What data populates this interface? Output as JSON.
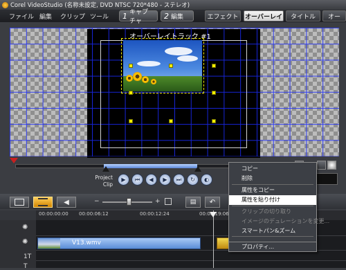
{
  "window": {
    "title": "Corel VideoStudio (名称未設定, DVD NTSC 720*480 - ステレオ)"
  },
  "menu": [
    "ファイル",
    "編集",
    "クリップ",
    "ツール"
  ],
  "steps": [
    {
      "num": "1",
      "label": "キャプチャ"
    },
    {
      "num": "2",
      "label": "編集"
    }
  ],
  "tabs": [
    {
      "label": "エフェクト",
      "active": false
    },
    {
      "label": "オーバーレイ",
      "active": true
    },
    {
      "label": "タイトル",
      "active": false
    },
    {
      "label": "オー",
      "active": false
    }
  ],
  "preview": {
    "overlay_label": "オーバーレイトラック #1"
  },
  "transport": {
    "project_label": "Project",
    "clip_label": "Clip"
  },
  "timeline": {
    "ruler": [
      "00:00:00:00",
      "00:00:06:12",
      "00:00:12:24",
      "00:00:19:06"
    ],
    "clip_name": "V13.wmv",
    "title_track_icons": [
      "1T",
      "T"
    ]
  },
  "context_menu": {
    "items": [
      {
        "label": "コピー",
        "enabled": true
      },
      {
        "label": "削除",
        "enabled": true
      },
      {
        "label": "属性をコピー",
        "enabled": true
      },
      {
        "label": "属性を貼り付け",
        "enabled": true,
        "selected": true
      },
      {
        "label": "クリップの切り取り",
        "enabled": false
      },
      {
        "label": "イメージのデュレーションを変更...",
        "enabled": false
      },
      {
        "label": "スマートパン&ズーム",
        "enabled": true
      },
      {
        "label": "プロパティ...",
        "enabled": true
      }
    ]
  },
  "colors": {
    "grid": "#1c2cff",
    "handle": "#f5ee00",
    "accent": "#ffcf5a"
  }
}
